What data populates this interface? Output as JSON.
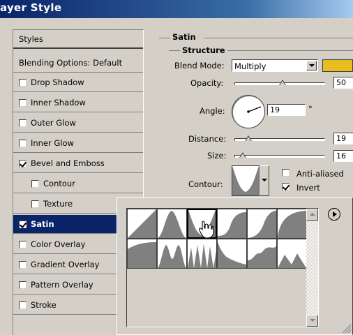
{
  "window": {
    "title": "ayer Style"
  },
  "styles_list": {
    "header": "Styles",
    "blending": "Blending Options: Default",
    "items": [
      {
        "label": "Drop Shadow",
        "checked": false
      },
      {
        "label": "Inner Shadow",
        "checked": false
      },
      {
        "label": "Outer Glow",
        "checked": false
      },
      {
        "label": "Inner Glow",
        "checked": false
      },
      {
        "label": "Bevel and Emboss",
        "checked": true
      },
      {
        "label": "Contour",
        "checked": false
      },
      {
        "label": "Texture",
        "checked": false
      },
      {
        "label": "Satin",
        "checked": true,
        "selected": true
      },
      {
        "label": "Color Overlay",
        "checked": false
      },
      {
        "label": "Gradient Overlay",
        "checked": false
      },
      {
        "label": "Pattern Overlay",
        "checked": false
      },
      {
        "label": "Stroke",
        "checked": false
      }
    ]
  },
  "satin": {
    "section_title": "Satin",
    "structure_title": "Structure",
    "blend_mode_label": "Blend Mode:",
    "blend_mode_value": "Multiply",
    "blend_color": "#e8bd20",
    "opacity_label": "Opacity:",
    "opacity_value": "50",
    "opacity_level": 0.5,
    "angle_label": "Angle:",
    "angle_value": "19",
    "angle_unit": "°",
    "distance_label": "Distance:",
    "distance_value": "19",
    "size_label": "Size:",
    "size_value": "16",
    "contour_label": "Contour:",
    "anti_aliased_label": "Anti-aliased",
    "anti_aliased_checked": false,
    "invert_label": "Invert",
    "invert_checked": true
  },
  "contour_picker": {
    "selected_index": 2,
    "icons": [
      "play-menu-icon",
      "hand-cursor-icon",
      "resize-grip-icon"
    ]
  }
}
